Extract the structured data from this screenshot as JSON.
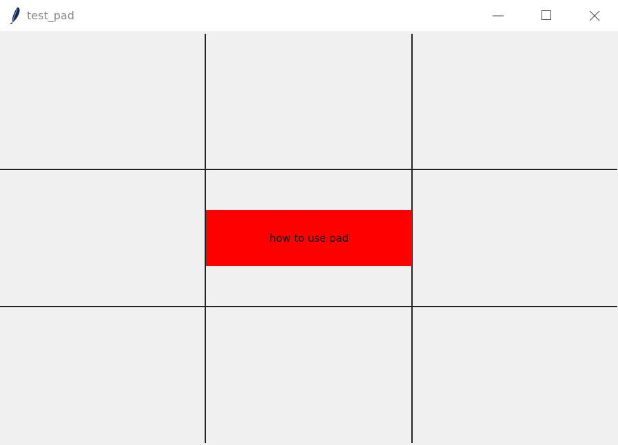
{
  "window": {
    "title": "test_pad",
    "icons": {
      "app": "feather-icon",
      "minimize": "minimize-icon",
      "maximize": "maximize-icon",
      "close": "close-icon"
    }
  },
  "content": {
    "label_text": "how to use pad"
  },
  "colors": {
    "window_background": "#f0f0f0",
    "titlebar_background": "#ffffff",
    "grid_line": "#222222",
    "label_background": "#ff0000",
    "label_text": "#000000"
  }
}
